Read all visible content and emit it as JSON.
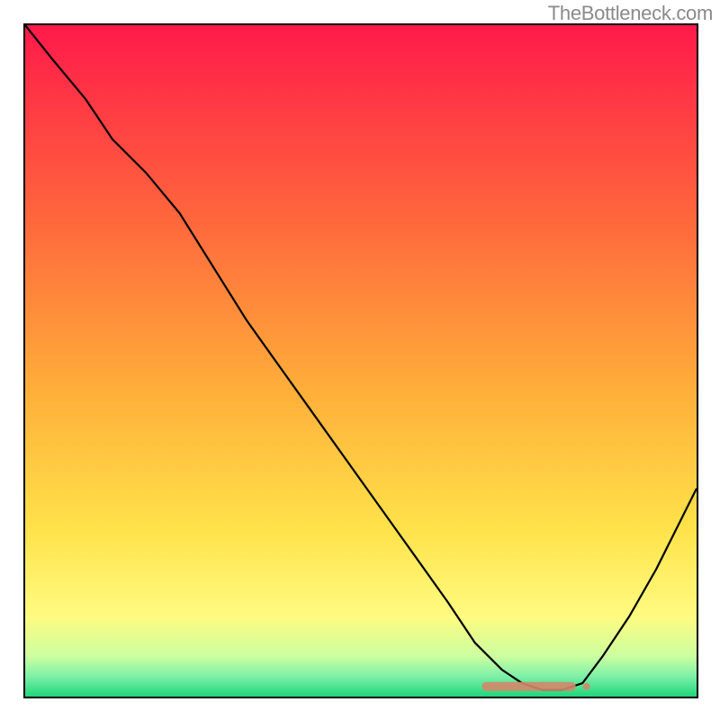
{
  "watermark": "TheBottleneck.com",
  "colors": {
    "gradient": [
      {
        "offset": "0%",
        "color": "#ff1a4a"
      },
      {
        "offset": "30%",
        "color": "#ff6a3c"
      },
      {
        "offset": "55%",
        "color": "#ffb03a"
      },
      {
        "offset": "75%",
        "color": "#ffe24a"
      },
      {
        "offset": "88%",
        "color": "#fffb80"
      },
      {
        "offset": "94%",
        "color": "#ccffa0"
      },
      {
        "offset": "97%",
        "color": "#7df0a8"
      },
      {
        "offset": "100%",
        "color": "#1fd67a"
      }
    ],
    "curve": "#000000",
    "marker": "#d4876a"
  },
  "chart_data": {
    "type": "line",
    "title": "",
    "xlabel": "",
    "ylabel": "",
    "xlim": [
      0,
      100
    ],
    "ylim": [
      0,
      100
    ],
    "x": [
      0,
      4,
      9,
      13,
      18,
      23,
      28,
      33,
      38,
      43,
      48,
      53,
      58,
      63,
      67,
      71,
      74,
      77,
      80,
      83,
      86,
      90,
      94,
      97,
      100
    ],
    "y": [
      100,
      95,
      89,
      83,
      78,
      72,
      64,
      56,
      49,
      42,
      35,
      28,
      21,
      14,
      8,
      4,
      2,
      1,
      1,
      2,
      6,
      12,
      19,
      25,
      31
    ],
    "optimal_marker": {
      "x_start": 68,
      "x_end": 82,
      "y": 1.5
    }
  }
}
